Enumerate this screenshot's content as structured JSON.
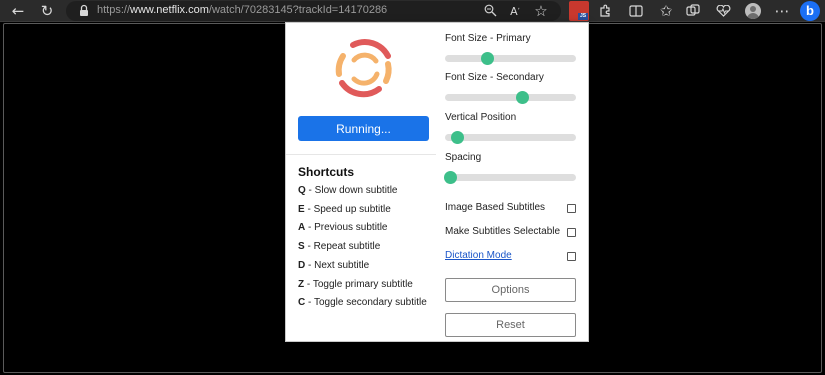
{
  "browser": {
    "url_prefix": "https://",
    "url_host": "www.netflix.com",
    "url_path": "/watch/70283145?trackId=14170286"
  },
  "popup": {
    "running_label": "Running...",
    "sliders": [
      {
        "label": "Font Size - Primary",
        "value_fraction": 0.32
      },
      {
        "label": "Font Size - Secondary",
        "value_fraction": 0.59
      },
      {
        "label": "Vertical Position",
        "value_fraction": 0.09
      },
      {
        "label": "Spacing",
        "value_fraction": 0.04
      }
    ],
    "shortcuts_title": "Shortcuts",
    "shortcuts": [
      {
        "key": "Q",
        "desc": "Slow down subtitle"
      },
      {
        "key": "E",
        "desc": "Speed up subtitle"
      },
      {
        "key": "A",
        "desc": "Previous subtitle"
      },
      {
        "key": "S",
        "desc": "Repeat subtitle"
      },
      {
        "key": "D",
        "desc": "Next subtitle"
      },
      {
        "key": "Z",
        "desc": "Toggle primary subtitle"
      },
      {
        "key": "C",
        "desc": "Toggle secondary subtitle"
      }
    ],
    "checkboxes": [
      {
        "label": "Image Based Subtitles",
        "checked": false
      },
      {
        "label": "Make Subtitles Selectable",
        "checked": false
      },
      {
        "label": "Dictation Mode",
        "checked": false
      }
    ],
    "options_label": "Options",
    "reset_label": "Reset"
  },
  "colors": {
    "accent_blue": "#1a73e8",
    "slider_thumb": "#3dbf8a",
    "logo_red": "#e05a5a",
    "logo_orange": "#f5b26b"
  }
}
